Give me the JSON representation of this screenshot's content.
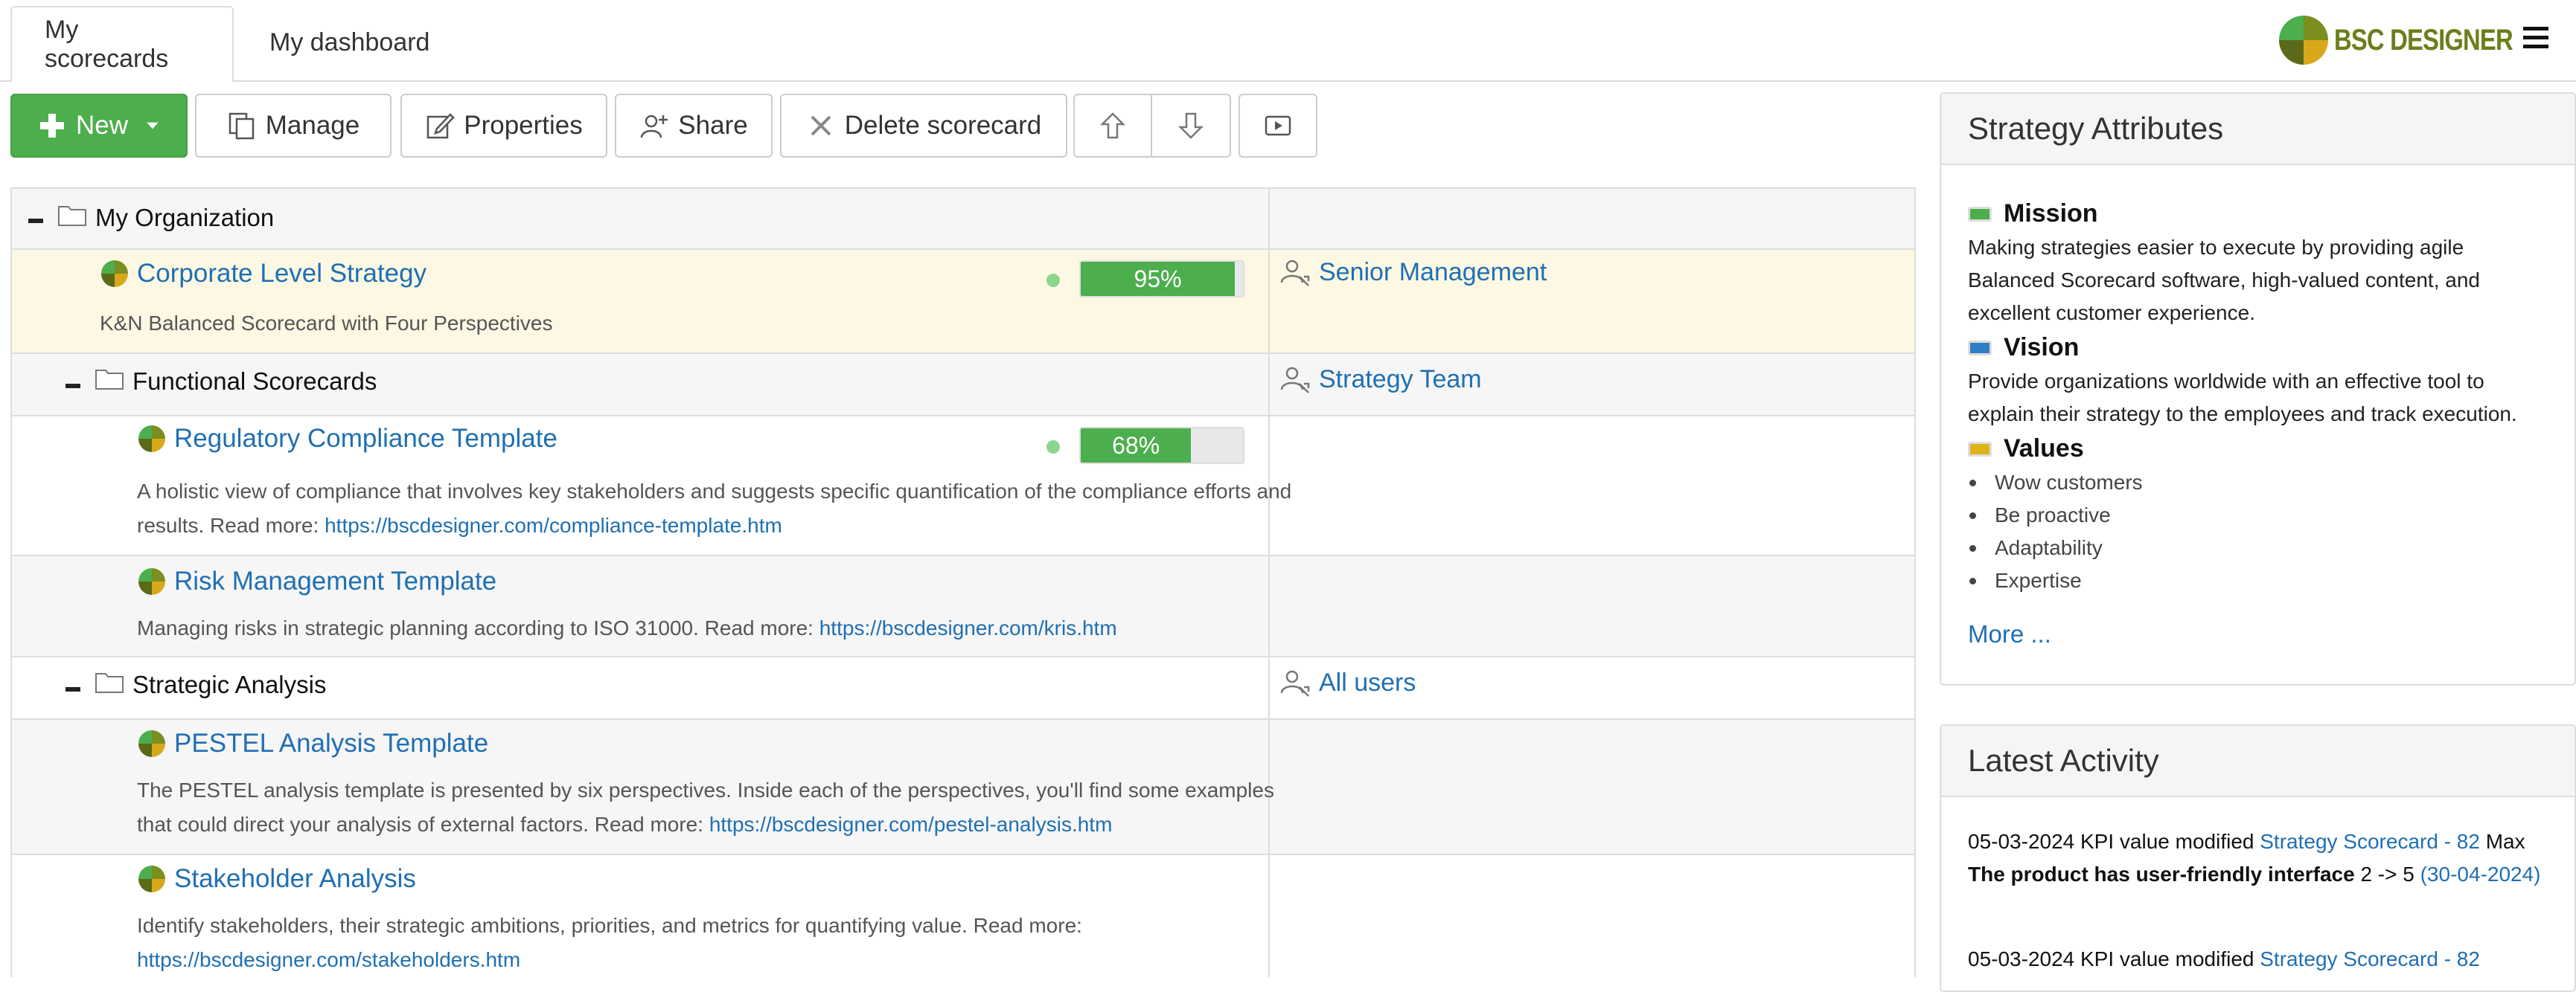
{
  "tabs": [
    {
      "label": "My scorecards",
      "active": true
    },
    {
      "label": "My dashboard",
      "active": false
    }
  ],
  "logo": {
    "text": "BSC DESIGNER"
  },
  "toolbar": {
    "new_label": "New",
    "manage_label": "Manage",
    "properties_label": "Properties",
    "share_label": "Share",
    "delete_label": "Delete scorecard"
  },
  "tree": {
    "root": {
      "label": "My Organization"
    },
    "corporate": {
      "title": "Corporate Level Strategy",
      "description": "K&N Balanced Scorecard with Four Perspectives",
      "progress": 0.95,
      "progress_label": "95%",
      "owner": "Senior Management"
    },
    "functional": {
      "label": "Functional Scorecards",
      "owner": "Strategy Team"
    },
    "regulatory": {
      "title": "Regulatory Compliance Template",
      "description": "A holistic view of compliance that involves key stakeholders and suggests specific quantification of the compliance efforts and results. Read more: ",
      "link": "https://bscdesigner.com/compliance-template.htm",
      "progress": 0.68,
      "progress_label": "68%"
    },
    "risk": {
      "title": "Risk Management Template",
      "description": "Managing risks in strategic planning according to ISO 31000. Read more: ",
      "link": "https://bscdesigner.com/kris.htm"
    },
    "strategic": {
      "label": "Strategic Analysis",
      "owner": "All users"
    },
    "pestel": {
      "title": "PESTEL Analysis Template",
      "description": "The PESTEL analysis template is presented by six perspectives. Inside each of the perspectives, you'll find some examples that could direct your analysis of external factors. Read more: ",
      "link": "https://bscdesigner.com/pestel-analysis.htm"
    },
    "stakeholder": {
      "title": "Stakeholder Analysis",
      "description": "Identify stakeholders, their strategic ambitions, priorities, and metrics for quantifying value. Read more: ",
      "link": "https://bscdesigner.com/stakeholders.htm"
    }
  },
  "strategy_attributes": {
    "title": "Strategy Attributes",
    "mission": {
      "title": "Mission",
      "color": "#4cae4c",
      "text": "Making strategies easier to execute by providing agile Balanced Scorecard software, high-valued content, and excellent customer experience."
    },
    "vision": {
      "title": "Vision",
      "color": "#2f7fc4",
      "text": "Provide organizations worldwide with an effective tool to explain their strategy to the employees and track execution."
    },
    "values": {
      "title": "Values",
      "color": "#e0b21a",
      "items": [
        "Wow customers",
        "Be proactive",
        "Adaptability",
        "Expertise"
      ]
    },
    "more_label": "More ..."
  },
  "latest_activity": {
    "title": "Latest Activity",
    "items": [
      {
        "date_text": "05-03-2024 KPI value modified ",
        "scorecard": "Strategy Scorecard - 82",
        "user": " Max ",
        "kpi": "The product has user-friendly interface",
        "change": " 2 -> 5 ",
        "period": "(30-04-2024)"
      },
      {
        "date_text": "05-03-2024 KPI value modified ",
        "scorecard": "Strategy Scorecard - 82"
      }
    ]
  }
}
